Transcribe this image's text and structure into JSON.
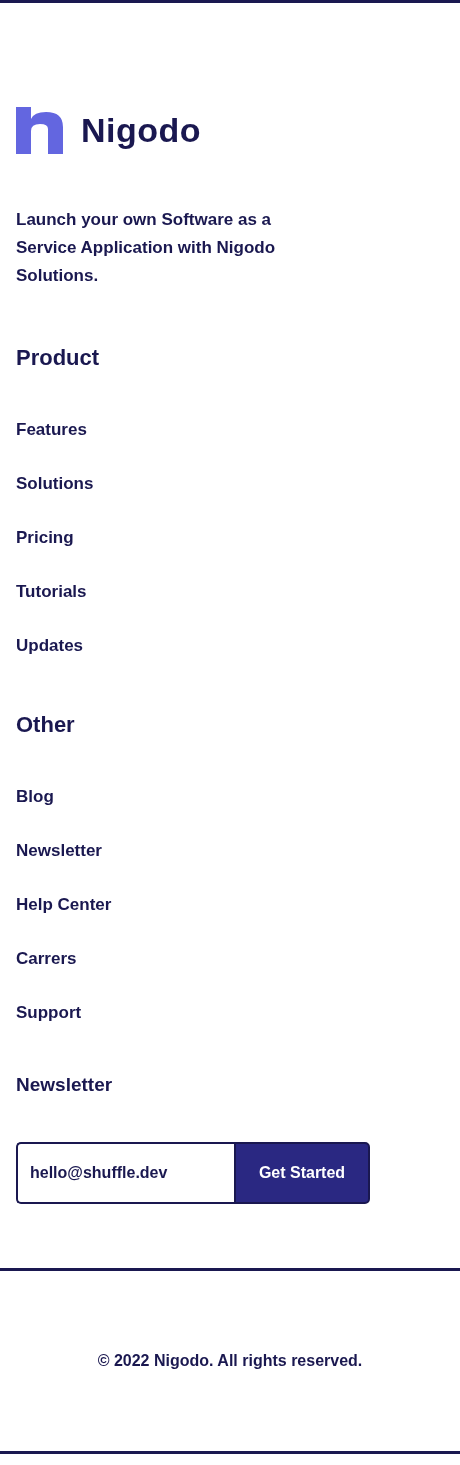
{
  "brand": {
    "name": "Nigodo"
  },
  "tagline": "Launch your own Software as a Service Application with Nigodo Solutions.",
  "sections": [
    {
      "title": "Product",
      "links": [
        "Features",
        "Solutions",
        "Pricing",
        "Tutorials",
        "Updates"
      ]
    },
    {
      "title": "Other",
      "links": [
        "Blog",
        "Newsletter",
        "Help Center",
        "Carrers",
        "Support"
      ]
    }
  ],
  "newsletter": {
    "title": "Newsletter",
    "email": "hello@shuffle.dev",
    "button": "Get Started"
  },
  "copyright": "© 2022 Nigodo. All rights reserved."
}
